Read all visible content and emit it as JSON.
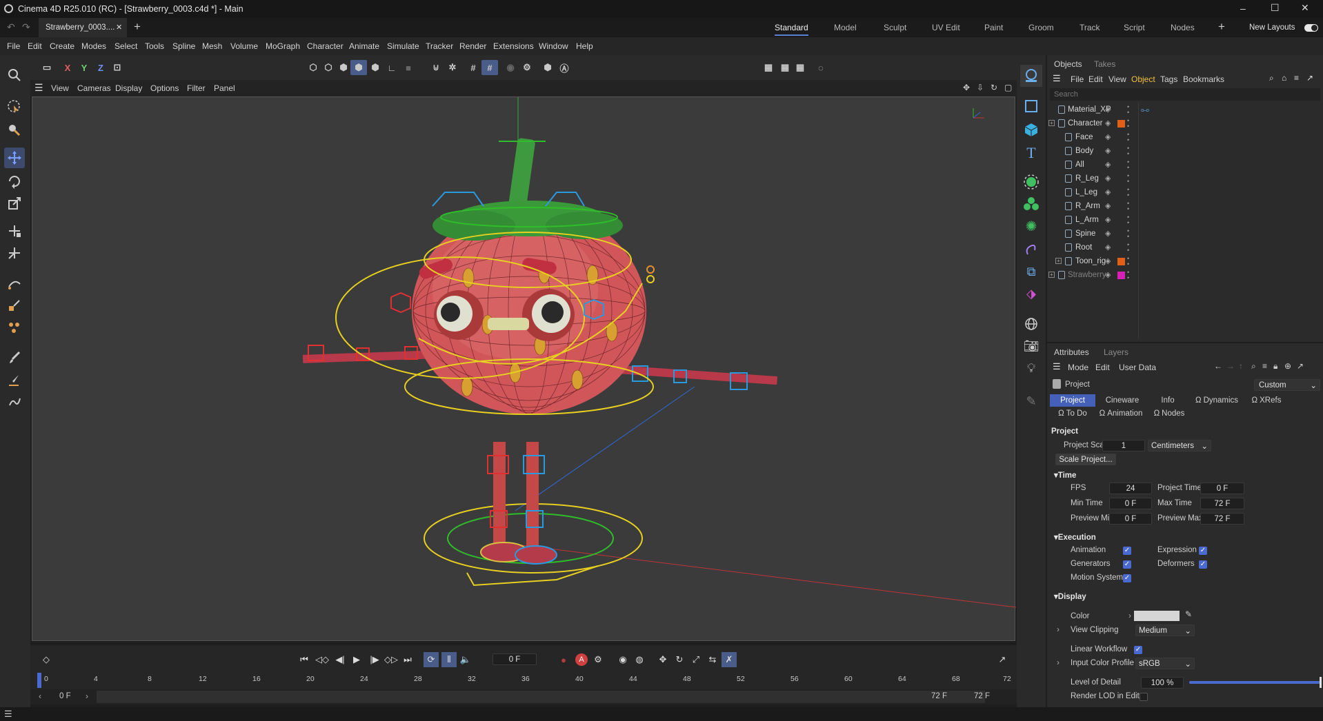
{
  "window": {
    "title": "Cinema 4D R25.010 (RC) - [Strawberry_0003.c4d *] - Main",
    "controls": [
      "–",
      "☐",
      "✕"
    ]
  },
  "tabs": {
    "doc_tab": "Strawberry_0003....",
    "layouts": [
      "Standard",
      "Model",
      "Sculpt",
      "UV Edit",
      "Paint",
      "Groom",
      "Track",
      "Script",
      "Nodes"
    ],
    "active_layout": "Standard",
    "new_layouts": "New Layouts"
  },
  "menu": [
    "File",
    "Edit",
    "Create",
    "Modes",
    "Select",
    "Tools",
    "Spline",
    "Mesh",
    "Volume",
    "MoGraph",
    "Character",
    "Animate",
    "Simulate",
    "Tracker",
    "Render",
    "Extensions",
    "Window",
    "Help"
  ],
  "toolbar": {
    "axes": [
      "X",
      "Y",
      "Z"
    ]
  },
  "viewport_menu": [
    "View",
    "Cameras",
    "Display",
    "Options",
    "Filter",
    "Panel"
  ],
  "timeline": {
    "current_frame": "0 F",
    "ticks": [
      "0",
      "4",
      "8",
      "12",
      "16",
      "20",
      "24",
      "28",
      "32",
      "36",
      "40",
      "44",
      "48",
      "52",
      "56",
      "60",
      "64",
      "68",
      "72"
    ],
    "range_start": "0 F",
    "range_start2": "0 F",
    "range_end": "72 F",
    "range_end2": "72 F"
  },
  "objects_panel": {
    "tabs": [
      "Objects",
      "Takes"
    ],
    "menu": [
      "File",
      "Edit",
      "View",
      "Object",
      "Tags",
      "Bookmarks"
    ],
    "search_placeholder": "Search",
    "items": [
      {
        "name": "Material_XP",
        "color": ""
      },
      {
        "name": "Character",
        "color": "#e0601a"
      },
      {
        "name": "Face",
        "color": ""
      },
      {
        "name": "Body",
        "color": ""
      },
      {
        "name": "All",
        "color": ""
      },
      {
        "name": "R_Leg",
        "color": ""
      },
      {
        "name": "L_Leg",
        "color": ""
      },
      {
        "name": "R_Arm",
        "color": ""
      },
      {
        "name": "L_Arm",
        "color": ""
      },
      {
        "name": "Spine",
        "color": ""
      },
      {
        "name": "Root",
        "color": ""
      },
      {
        "name": "Toon_rig",
        "color": "#e0601a"
      },
      {
        "name": "Strawberry",
        "color": "#d81fb8"
      }
    ]
  },
  "attributes_panel": {
    "tabs": [
      "Attributes",
      "Layers"
    ],
    "menu": [
      "Mode",
      "Edit",
      "User Data"
    ],
    "object_name": "Project",
    "preset": "Custom",
    "tabs_row1": [
      "Project",
      "Cineware",
      "Info",
      "Dynamics",
      "XRefs"
    ],
    "tabs_row2": [
      "To Do",
      "Animation",
      "Nodes"
    ],
    "section_title": "Project",
    "project_scale_label": "Project Scale",
    "project_scale_value": "1",
    "project_scale_unit": "Centimeters",
    "scale_project_btn": "Scale Project...",
    "time_section": "Time",
    "fps_label": "FPS",
    "fps_value": "24",
    "project_time_label": "Project Time",
    "project_time_value": "0 F",
    "min_time_label": "Min Time",
    "min_time_value": "0 F",
    "max_time_label": "Max Time",
    "max_time_value": "72 F",
    "preview_min_label": "Preview Min",
    "preview_min_value": "0 F",
    "preview_max_label": "Preview Max",
    "preview_max_value": "72 F",
    "execution_section": "Execution",
    "animation_label": "Animation",
    "expression_label": "Expression",
    "generators_label": "Generators",
    "deformers_label": "Deformers",
    "motion_system_label": "Motion System",
    "display_section": "Display",
    "color_label": "Color",
    "view_clipping_label": "View Clipping",
    "view_clipping_value": "Medium",
    "linear_workflow_label": "Linear Workflow",
    "input_color_profile_label": "Input Color Profile",
    "input_color_profile_value": "sRGB",
    "lod_label": "Level of Detail",
    "lod_value": "100 %",
    "lod_fraction": 1.0,
    "render_lod_label": "Render LOD in Editor"
  }
}
